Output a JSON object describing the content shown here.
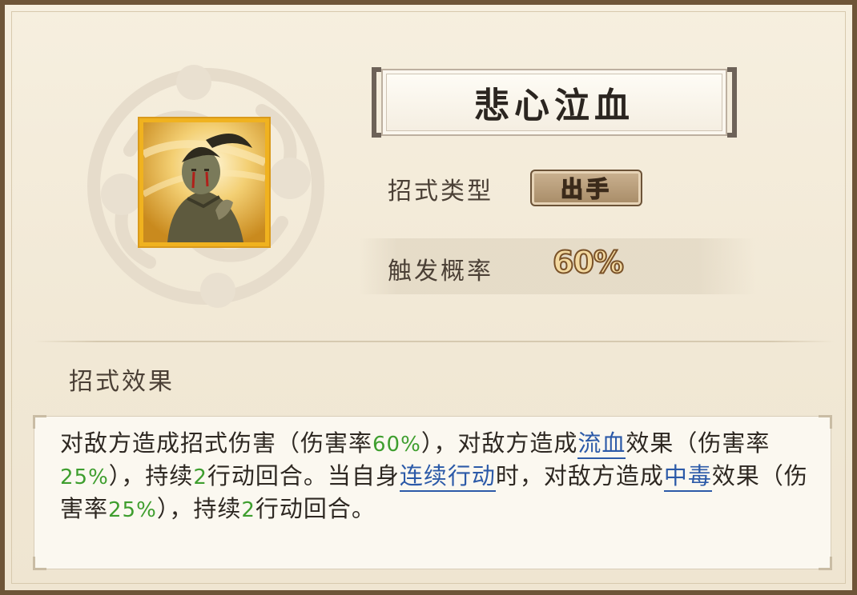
{
  "skill": {
    "name": "悲心泣血",
    "type_label": "招式类型",
    "type_value": "出手",
    "rate_label": "触发概率",
    "rate_value": "60%",
    "icon": "weeping-swordsman-portrait-icon"
  },
  "effect": {
    "heading": "招式效果",
    "segments": [
      {
        "text": "对敌方造成招式伤害（伤害率",
        "style": "plain"
      },
      {
        "text": "60%",
        "style": "num"
      },
      {
        "text": "），对敌方造成",
        "style": "plain"
      },
      {
        "text": "流血",
        "style": "kw"
      },
      {
        "text": "效果（伤害率",
        "style": "plain"
      },
      {
        "text": "25%",
        "style": "num"
      },
      {
        "text": "），持续",
        "style": "plain"
      },
      {
        "text": "2",
        "style": "num"
      },
      {
        "text": "行动回合。当自身",
        "style": "plain"
      },
      {
        "text": "连续行动",
        "style": "kw"
      },
      {
        "text": "时，对敌方造成",
        "style": "plain"
      },
      {
        "text": "中毒",
        "style": "kw"
      },
      {
        "text": "效果（伤害率",
        "style": "plain"
      },
      {
        "text": "25%",
        "style": "num"
      },
      {
        "text": "），持续",
        "style": "plain"
      },
      {
        "text": "2",
        "style": "num"
      },
      {
        "text": "行动回合。",
        "style": "plain"
      }
    ]
  },
  "colors": {
    "highlight_number": "#3e9e2e",
    "keyword_link": "#2c5aa8",
    "frame_gold": "#f0b21f"
  }
}
